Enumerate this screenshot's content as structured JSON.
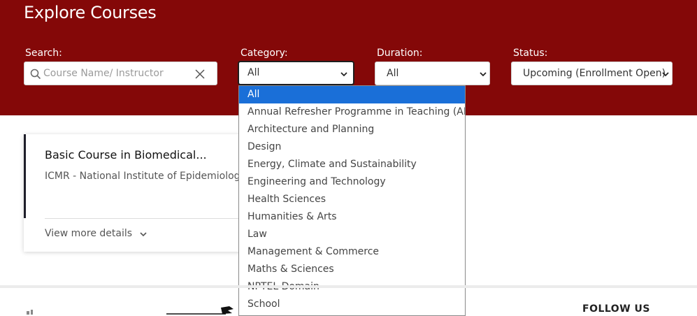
{
  "header": {
    "title": "Explore Courses",
    "bg_color": "#840808"
  },
  "filters": {
    "search_label": "Search:",
    "search_placeholder": "Course Name/ Instructor",
    "category_label": "Category:",
    "category_value": "All",
    "duration_label": "Duration:",
    "duration_value": "All",
    "status_label": "Status:",
    "status_value": "Upcoming (Enrollment Open)"
  },
  "category_options": [
    "All",
    "Annual Refresher Programme in Teaching (ARPIT)",
    "Architecture and Planning",
    "Design",
    "Energy, Climate and Sustainability",
    "Engineering and Technology",
    "Health Sciences",
    "Humanities & Arts",
    "Law",
    "Management & Commerce",
    "Maths & Sciences",
    "NPTEL Domain",
    "School"
  ],
  "selected_option_color": "#1a6fd8",
  "course_card": {
    "title": "Basic Course in Biomedical...",
    "institute": "ICMR - National Institute of Epidemiology",
    "view_more": "View more details"
  },
  "footer": {
    "follow_us": "FOLLOW US"
  }
}
